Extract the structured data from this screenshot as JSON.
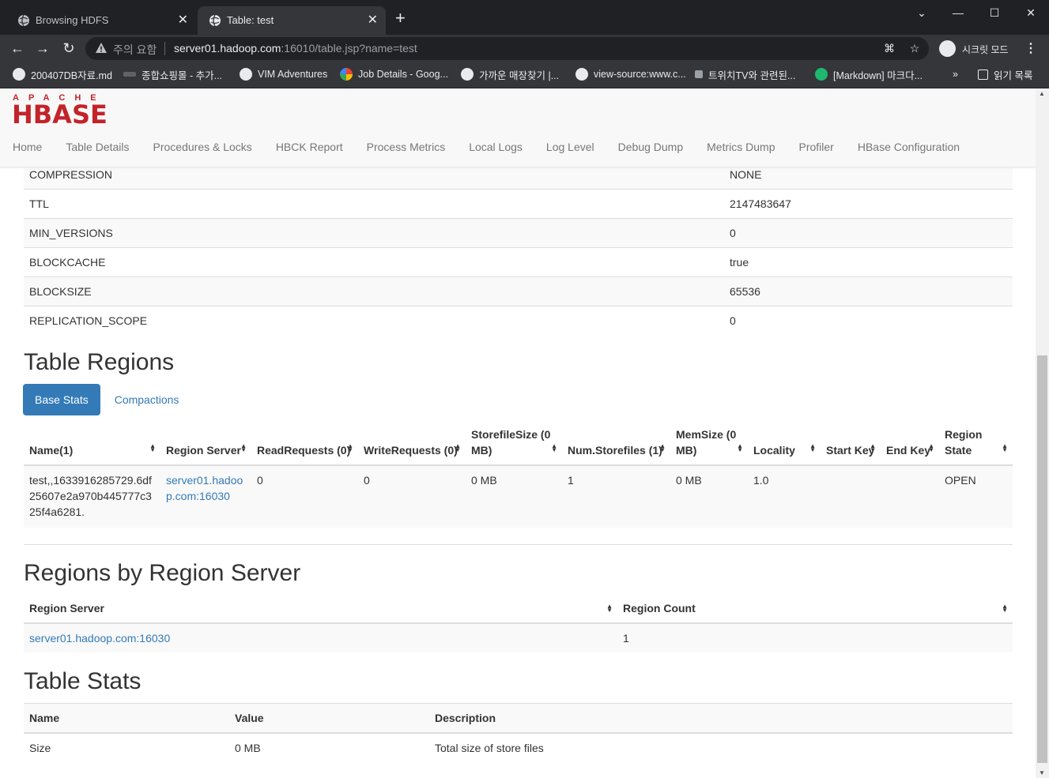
{
  "browser": {
    "tabs": [
      {
        "title": "Browsing HDFS",
        "active": false
      },
      {
        "title": "Table: test",
        "active": true
      }
    ],
    "security_label": "주의 요함",
    "url_host": "server01.hadoop.com",
    "url_rest": ":16010/table.jsp?name=test",
    "incognito_label": "시크릿 모드",
    "bookmarks": [
      "200407DB자료.md",
      "종합쇼핑몰 - 추가...",
      "VIM Adventures",
      "Job Details - Goog...",
      "가까운 매장찾기 |...",
      "view-source:www.c...",
      "트위치TV와 관련된...",
      "[Markdown] 마크다...",
      "»",
      "읽기 목록"
    ]
  },
  "hbase": {
    "logo_top": "APACHE",
    "logo_main": "HBASE",
    "nav": [
      "Home",
      "Table Details",
      "Procedures & Locks",
      "HBCK Report",
      "Process Metrics",
      "Local Logs",
      "Log Level",
      "Debug Dump",
      "Metrics Dump",
      "Profiler",
      "HBase Configuration"
    ]
  },
  "properties": [
    {
      "name": "COMPRESSION",
      "value": "NONE"
    },
    {
      "name": "TTL",
      "value": "2147483647"
    },
    {
      "name": "MIN_VERSIONS",
      "value": "0"
    },
    {
      "name": "BLOCKCACHE",
      "value": "true"
    },
    {
      "name": "BLOCKSIZE",
      "value": "65536"
    },
    {
      "name": "REPLICATION_SCOPE",
      "value": "0"
    }
  ],
  "table_regions": {
    "heading": "Table Regions",
    "tab_base": "Base Stats",
    "tab_compactions": "Compactions",
    "headers": [
      "Name(1)",
      "Region Server",
      "ReadRequests (0)",
      "WriteRequests (0)",
      "StorefileSize (0 MB)",
      "Num.Storefiles (1)",
      "MemSize (0 MB)",
      "Locality",
      "Start Key",
      "End Key",
      "Region State"
    ],
    "row": {
      "name": "test,,1633916285729.6df25607e2a970b445777c325f4a6281.",
      "server": "server01.hadoop.com:16030",
      "read": "0",
      "write": "0",
      "storefile_size": "0 MB",
      "num_storefiles": "1",
      "memsize": "0 MB",
      "locality": "1.0",
      "start_key": "",
      "end_key": "",
      "state": "OPEN"
    }
  },
  "regions_by_server": {
    "heading": "Regions by Region Server",
    "headers": [
      "Region Server",
      "Region Count"
    ],
    "rows": [
      {
        "server": "server01.hadoop.com:16030",
        "count": "1"
      }
    ]
  },
  "table_stats": {
    "heading": "Table Stats",
    "headers": [
      "Name",
      "Value",
      "Description"
    ],
    "rows": [
      {
        "name": "Size",
        "value": "0 MB",
        "description": "Total size of store files"
      }
    ]
  }
}
